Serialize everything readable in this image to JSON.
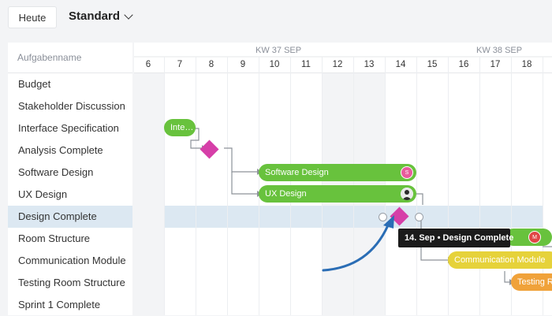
{
  "toolbar": {
    "today_label": "Heute",
    "view_label": "Standard"
  },
  "task_panel": {
    "header": "Aufgabenname",
    "tasks": [
      "Budget",
      "Stakeholder Discussion",
      "Interface Specification",
      "Analysis Complete",
      "Software Design",
      "UX Design",
      "Design Complete",
      "Room Structure",
      "Communication Module",
      "Testing Room Structure",
      "Sprint 1 Complete"
    ],
    "selected_task": "Design Complete"
  },
  "timeline": {
    "weeks": [
      {
        "label": "KW 37 SEP"
      },
      {
        "label": "KW 38 SEP"
      }
    ],
    "days": [
      "6",
      "7",
      "8",
      "9",
      "10",
      "11",
      "12",
      "13",
      "14",
      "15",
      "16",
      "17",
      "18"
    ]
  },
  "bars": {
    "interface": {
      "label": "Inte…",
      "color": "#68c23d"
    },
    "software_design": {
      "label": "Software Design",
      "avatar": "S",
      "color": "#68c23d"
    },
    "ux_design": {
      "label": "UX Design",
      "color": "#68c23d"
    },
    "communication_module": {
      "label": "Communication Module",
      "avatar": "M",
      "color": "#e6d23a"
    },
    "testing_room": {
      "label": "Testing Ro",
      "color": "#f0a23a"
    }
  },
  "tooltip": {
    "text": "14. Sep • Design Complete"
  },
  "colors": {
    "milestone": "#d63fa8",
    "selected_row": "#dce8f2",
    "arrow": "#2a6db5"
  }
}
